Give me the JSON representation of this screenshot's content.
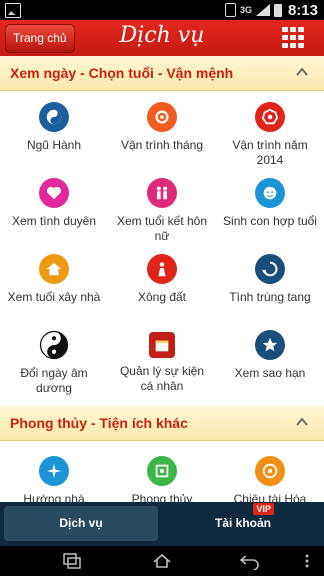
{
  "status_bar": {
    "network": "3G",
    "time": "8:13"
  },
  "header": {
    "back_label": "Trang chủ",
    "title": "Dịch vụ"
  },
  "sections": [
    {
      "title": "Xem ngày - Chọn tuổi - Vận mệnh",
      "items": [
        {
          "label": "Ngũ Hành",
          "icon": "yin-yang-five-elements-icon",
          "color": "#1d5e9c"
        },
        {
          "label": "Vận trình tháng",
          "icon": "wheel-month-icon",
          "color": "#f25b22"
        },
        {
          "label": "Vận trình năm 2014",
          "icon": "bagua-year-icon",
          "color": "#e0231b"
        },
        {
          "label": "Xem tình duyên",
          "icon": "heart-love-icon",
          "color": "#e0299b"
        },
        {
          "label": "Xem tuổi kết hôn nữ",
          "icon": "couple-icon",
          "color": "#de2a7a"
        },
        {
          "label": "Sinh con hợp tuổi",
          "icon": "baby-icon",
          "color": "#1b95d6"
        },
        {
          "label": "Xem tuổi xây nhà",
          "icon": "house-icon",
          "color": "#ef9a14"
        },
        {
          "label": "Xông đất",
          "icon": "first-visitor-icon",
          "color": "#e0231b"
        },
        {
          "label": "Tình trùng tang",
          "icon": "recycle-icon",
          "color": "#1c4e7c"
        },
        {
          "label": "Đổi ngày âm dương",
          "icon": "yin-yang-icon",
          "color": "#111111"
        },
        {
          "label": "Quản lý sự kiện cá nhân",
          "icon": "calendar-icon",
          "color": "#c21f1a"
        },
        {
          "label": "Xem sao hạn",
          "icon": "star-icon",
          "color": "#1c4e7c"
        }
      ]
    },
    {
      "title": "Phong thủy - Tiện ích khác",
      "items": [
        {
          "label": "Hướng nhà",
          "icon": "compass-icon",
          "color": "#1b95d6"
        },
        {
          "label": "Phong thủy",
          "icon": "fengshui-icon",
          "color": "#3cb44a"
        },
        {
          "label": "Chiêu tài Hóa",
          "icon": "coin-icon",
          "color": "#ef8f14"
        }
      ]
    }
  ],
  "tabs": [
    {
      "label": "Dịch vụ"
    },
    {
      "label": "Tài khoản",
      "badge": "VIP"
    }
  ]
}
